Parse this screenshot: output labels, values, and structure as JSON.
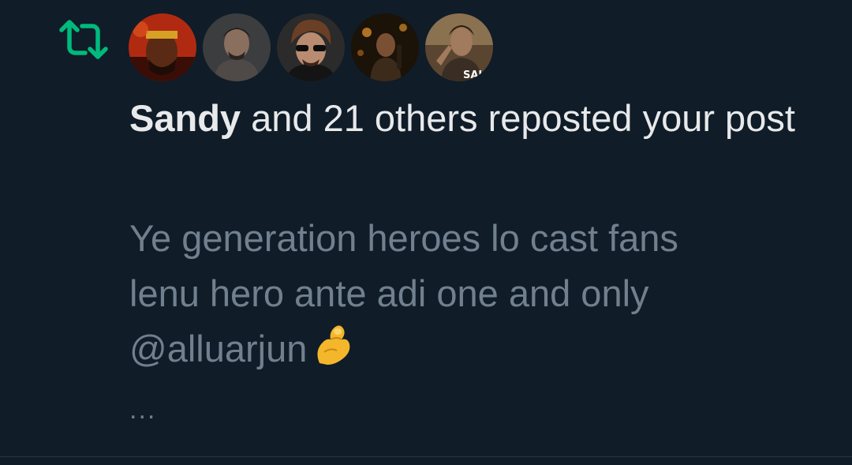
{
  "notification": {
    "type_icon": "repost-icon",
    "accent_color": "#00ba7c",
    "avatars": [
      {
        "icon": "avatar-1"
      },
      {
        "icon": "avatar-2"
      },
      {
        "icon": "avatar-3"
      },
      {
        "icon": "avatar-4"
      },
      {
        "icon": "avatar-5"
      }
    ],
    "actor_name": "Sandy",
    "action_text": " and 21 others reposted your post",
    "post_snippet": {
      "line1": "Ye generation heroes lo cast fans",
      "line2": "lenu hero ante adi one and only",
      "line3": "@alluarjun",
      "emoji": "pinched-fingers-emoji"
    },
    "more": "..."
  }
}
